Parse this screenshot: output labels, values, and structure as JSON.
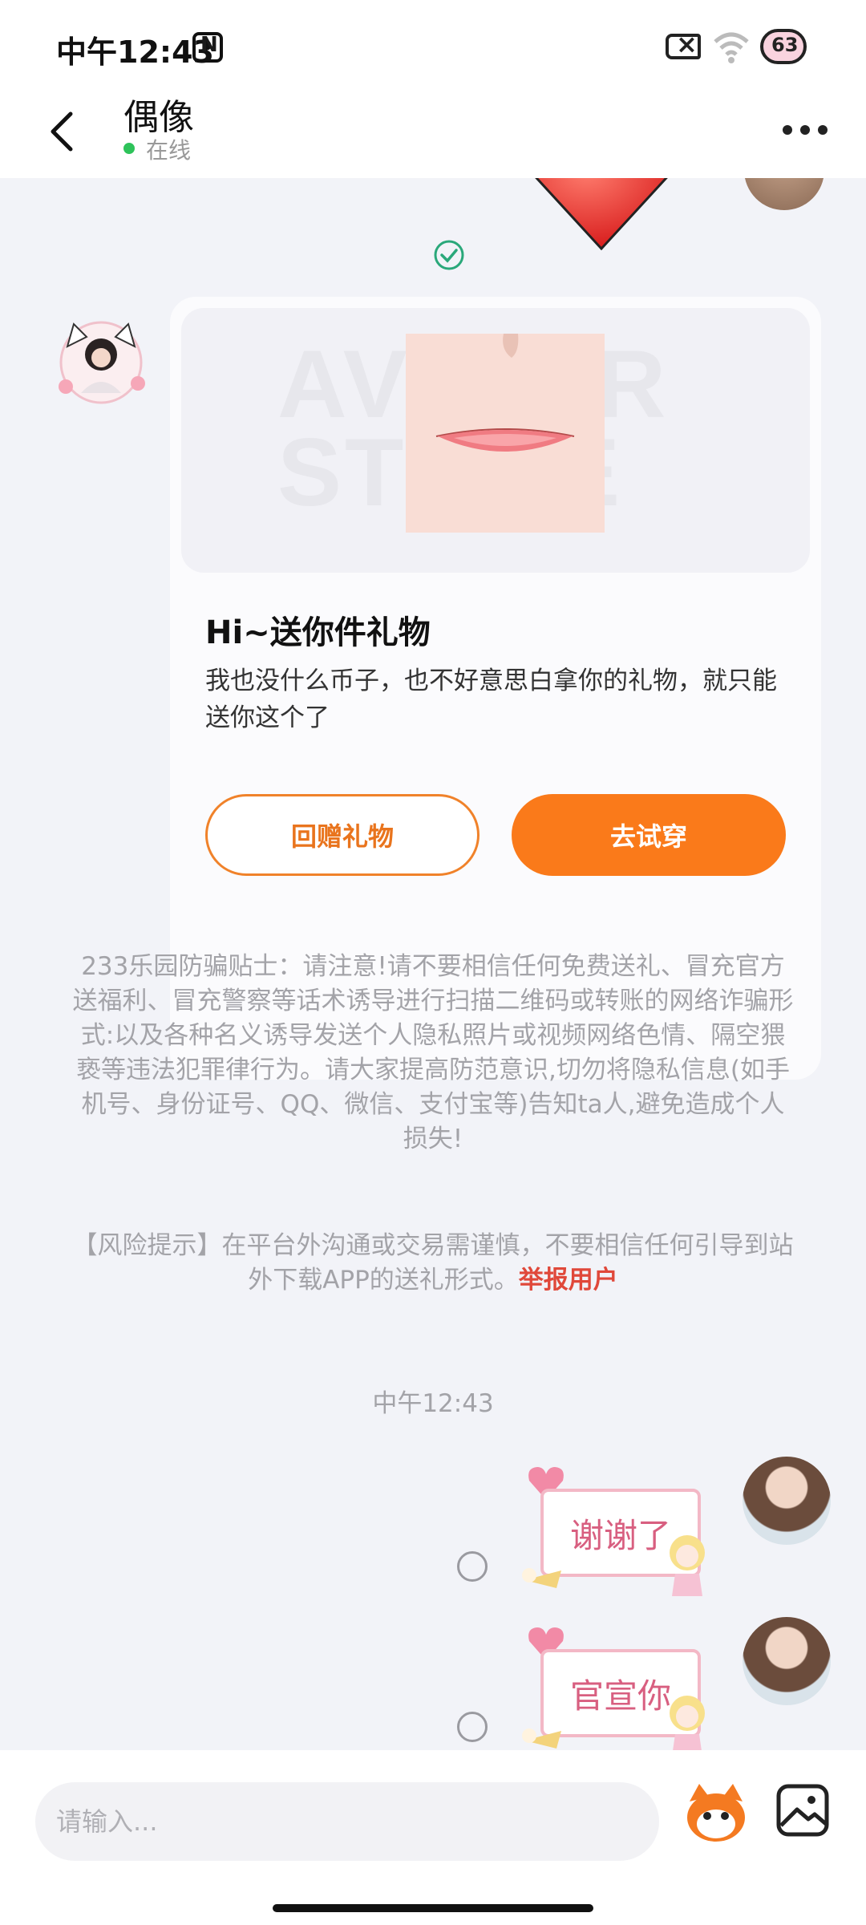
{
  "status_bar": {
    "time": "中午12:43",
    "battery": "63"
  },
  "header": {
    "title": "偶像",
    "status": "在线"
  },
  "gift_card": {
    "watermark": "AVATAR STORE",
    "title": "Hi~送你件礼物",
    "description": "我也没什么币子，也不好意思白拿你的礼物，就只能送你这个了",
    "return_gift_label": "回赠礼物",
    "try_on_label": "去试穿"
  },
  "notice": {
    "anti_fraud": "233乐园防骗贴士：请注意!请不要相信任何免费送礼、冒充官方送福利、冒充警察等话术诱导进行扫描二维码或转账的网络诈骗形式:以及各种名义诱导发送个人隐私照片或视频网络色情、隔空猥亵等违法犯罪律行为。请大家提高防范意识,切勿将隐私信息(如手机号、身份证号、QQ、微信、支付宝等)告知ta人,避免造成个人损失!",
    "risk_text": "【风险提示】在平台外沟通或交易需谨慎，不要相信任何引导到站外下载APP的送礼形式。",
    "report_label": "举报用户"
  },
  "messages": {
    "time": "中午12:43",
    "items": [
      {
        "text": "谢谢了"
      },
      {
        "text": "官宣你"
      }
    ]
  },
  "input": {
    "placeholder": "请输入..."
  },
  "colors": {
    "accent": "#fa7a1a",
    "online": "#2ec35a",
    "report": "#e0483a"
  }
}
